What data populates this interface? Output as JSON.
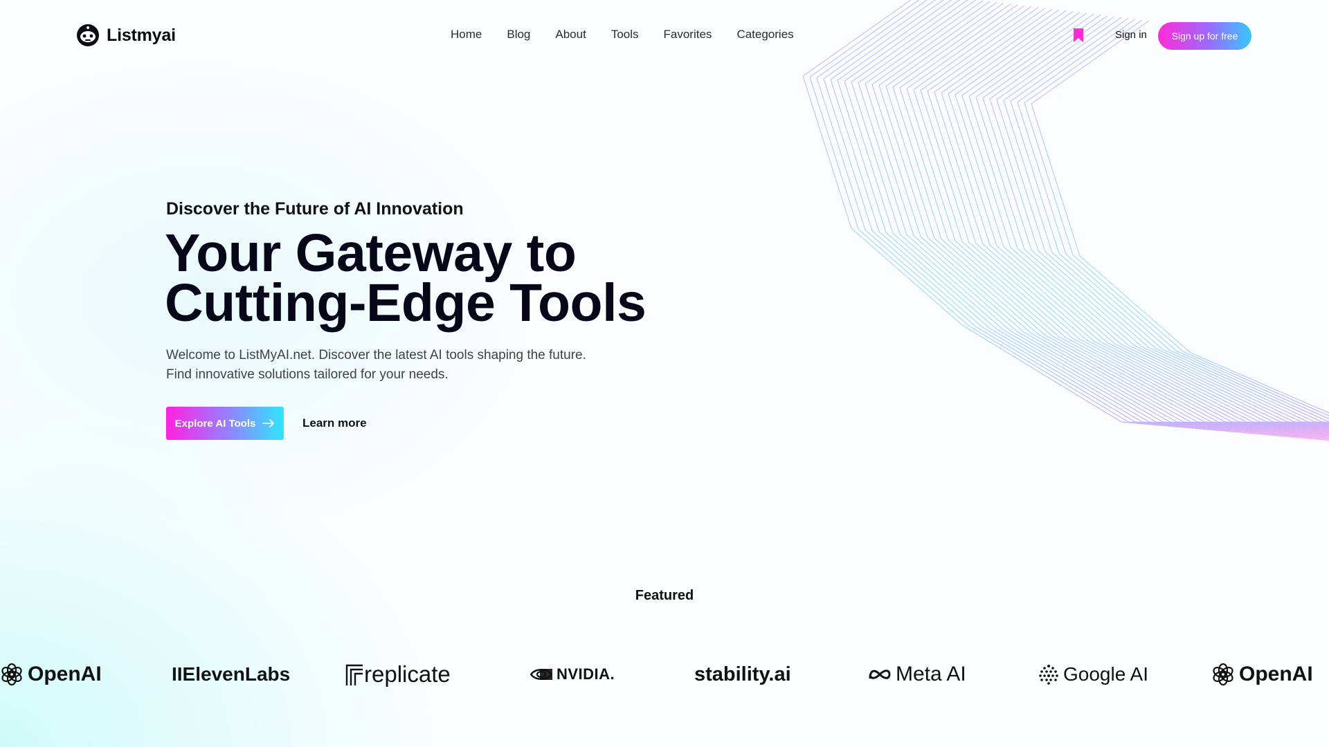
{
  "header": {
    "logo_text": "Listmyai",
    "nav": [
      "Home",
      "Blog",
      "About",
      "Tools",
      "Favorites",
      "Categories"
    ],
    "sign_in": "Sign in",
    "sign_up": "Sign up for free",
    "icons": {
      "logo": "robot-face-icon",
      "bookmark": "bookmark-icon"
    },
    "colors": {
      "bookmark": "#ff2bd6",
      "gradient_start": "#ff2bd6",
      "gradient_end": "#35c8ff"
    }
  },
  "hero": {
    "eyebrow": "Discover the Future of AI Innovation",
    "title_line1": "Your Gateway to",
    "title_line2": "Cutting-Edge Tools",
    "desc_line1": "Welcome to ListMyAI.net. Discover the latest AI tools shaping the future.",
    "desc_line2": "Find innovative solutions tailored for your needs.",
    "cta_primary": "Explore AI Tools",
    "cta_secondary": "Learn more",
    "cta_icon": "arrow-right-icon"
  },
  "featured": {
    "heading": "Featured",
    "logos": [
      {
        "name": "OpenAI",
        "icon": "openai-icon"
      },
      {
        "name": "IIElevenLabs",
        "icon": ""
      },
      {
        "name": "replicate",
        "icon": "replicate-icon"
      },
      {
        "name": "NVIDIA.",
        "icon": "nvidia-eye-icon"
      },
      {
        "name": "stability.ai",
        "icon": ""
      },
      {
        "name": "Meta AI",
        "icon": "meta-infinity-icon"
      },
      {
        "name": "Google AI",
        "icon": "google-dots-icon"
      },
      {
        "name": "OpenAI",
        "icon": "openai-icon"
      }
    ]
  }
}
